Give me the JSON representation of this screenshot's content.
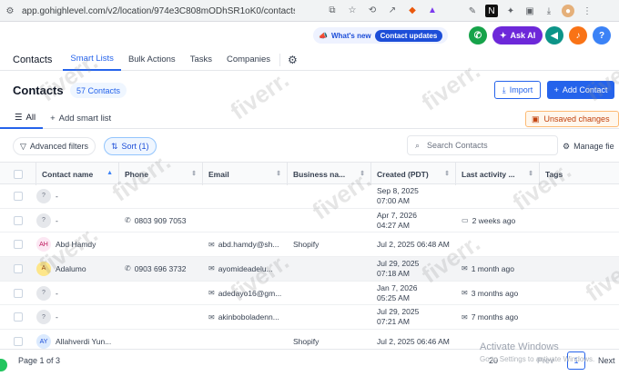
{
  "browser": {
    "url": "app.gohighlevel.com/v2/location/974e3C808mODhSR1oK0/contacts/smart_lis...",
    "icons": [
      "screen-share-icon",
      "star-icon",
      "history-icon",
      "trend-icon",
      "shield-icon",
      "triangle-icon",
      "pen-icon",
      "notion-icon",
      "puzzle-icon",
      "tabs-icon",
      "download-icon",
      "profile-icon",
      "menu-icon"
    ]
  },
  "topbar": {
    "whats_new": "What's new",
    "contact_updates": "Contact updates",
    "ask_ai": "Ask AI",
    "help": "?"
  },
  "nav": {
    "section": "Contacts",
    "tabs": [
      "Smart Lists",
      "Bulk Actions",
      "Tasks",
      "Companies"
    ]
  },
  "header": {
    "title": "Contacts",
    "count": "57 Contacts",
    "import_label": "Import",
    "add_label": "Add Contact"
  },
  "smartlists": {
    "all_label": "All",
    "add_label": "Add smart list",
    "unsaved": "Unsaved changes"
  },
  "filters": {
    "advanced": "Advanced filters",
    "sort": "Sort (1)",
    "search_placeholder": "Search Contacts",
    "manage": "Manage fie"
  },
  "table": {
    "columns": [
      "Contact name",
      "Phone",
      "Email",
      "Business na...",
      "Created (PDT)",
      "Last activity ...",
      "Tags"
    ],
    "rows": [
      {
        "avatar": "?",
        "avatar_bg": "#e5e7eb",
        "avatar_fg": "#6b7280",
        "name": "-",
        "phone": "",
        "email": "",
        "business": "",
        "created_date": "Sep 8, 2025",
        "created_time": "07:00 AM",
        "activity": "",
        "activity_icon": ""
      },
      {
        "avatar": "?",
        "avatar_bg": "#e5e7eb",
        "avatar_fg": "#6b7280",
        "name": "-",
        "phone": "0803 909 7053",
        "email": "",
        "business": "",
        "created_date": "Apr 7, 2026",
        "created_time": "04:27 AM",
        "activity": "2 weeks ago",
        "activity_icon": "chat-icon"
      },
      {
        "avatar": "AH",
        "avatar_bg": "#fce7f3",
        "avatar_fg": "#be185d",
        "name": "Abd Hamdy",
        "phone": "",
        "email": "abd.hamdy@sh...",
        "business": "Shopify",
        "created_date": "Jul 2, 2025 06:48 AM",
        "created_time": "",
        "activity": "",
        "activity_icon": ""
      },
      {
        "avatar": "A",
        "avatar_bg": "#fde68a",
        "avatar_fg": "#92400e",
        "name": "Adalumo",
        "phone": "0903 696 3732",
        "email": "ayomideadelu...",
        "business": "",
        "created_date": "Jul 29, 2025",
        "created_time": "07:18 AM",
        "activity": "1 month ago",
        "activity_icon": "mail-icon"
      },
      {
        "avatar": "?",
        "avatar_bg": "#e5e7eb",
        "avatar_fg": "#6b7280",
        "name": "-",
        "phone": "",
        "email": "adedayo16@gm...",
        "business": "",
        "created_date": "Jan 7, 2026",
        "created_time": "05:25 AM",
        "activity": "3 months ago",
        "activity_icon": "mail-icon"
      },
      {
        "avatar": "?",
        "avatar_bg": "#e5e7eb",
        "avatar_fg": "#6b7280",
        "name": "-",
        "phone": "",
        "email": "akinboboladenn...",
        "business": "",
        "created_date": "Jul 29, 2025",
        "created_time": "07:21 AM",
        "activity": "7 months ago",
        "activity_icon": "mail-icon"
      },
      {
        "avatar": "AY",
        "avatar_bg": "#dbeafe",
        "avatar_fg": "#1d4ed8",
        "name": "Allahverdi Yun...",
        "phone": "",
        "email": "",
        "business": "Shopify",
        "created_date": "Jul 2, 2025 06:46 AM",
        "created_time": "",
        "activity": "",
        "activity_icon": ""
      }
    ]
  },
  "footer": {
    "page": "Page 1 of 3",
    "page_size": "20",
    "prev": "Prev",
    "current": "1",
    "next": "Next"
  },
  "windows": {
    "activate": "Activate Windows",
    "settings": "Go to Settings to activate Windows."
  },
  "watermark": "fiverr."
}
